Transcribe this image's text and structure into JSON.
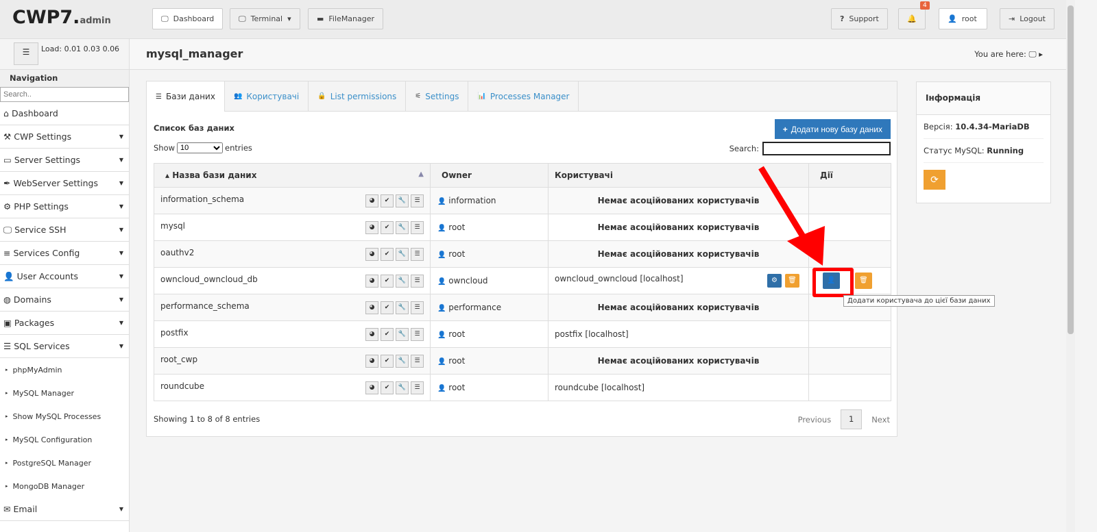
{
  "brand": {
    "name": "CWP7.",
    "suffix": "admin"
  },
  "topbar": {
    "dashboard": "Dashboard",
    "terminal": "Terminal",
    "filemanager": "FileManager",
    "support": "Support",
    "notifications": "4",
    "user": "root",
    "logout": "Logout"
  },
  "sidebar": {
    "load": "Load: 0.01  0.03  0.06",
    "nav_title": "Navigation",
    "search_placeholder": "Search..",
    "items": [
      {
        "label": "Dashboard",
        "icon": "home-icon"
      },
      {
        "label": "CWP Settings",
        "icon": "tools-icon"
      },
      {
        "label": "Server Settings",
        "icon": "server-icon"
      },
      {
        "label": "WebServer Settings",
        "icon": "feather-icon"
      },
      {
        "label": "PHP Settings",
        "icon": "gear-icon"
      },
      {
        "label": "Service SSH",
        "icon": "monitor-icon"
      },
      {
        "label": "Services Config",
        "icon": "list-icon"
      },
      {
        "label": "User Accounts",
        "icon": "user-icon"
      },
      {
        "label": "Domains",
        "icon": "globe-icon"
      },
      {
        "label": "Packages",
        "icon": "package-icon"
      },
      {
        "label": "SQL Services",
        "icon": "database-icon"
      }
    ],
    "sub": [
      "phpMyAdmin",
      "MySQL Manager",
      "Show MySQL Processes",
      "MySQL Configuration",
      "PostgreSQL Manager",
      "MongoDB Manager"
    ],
    "email": "Email"
  },
  "page": {
    "title": "mysql_manager",
    "you_are_here": "You are here:"
  },
  "tabs": [
    "Бази даних",
    "Користувачі",
    "List permissions",
    "Settings",
    "Processes Manager"
  ],
  "list": {
    "title": "Список баз даних",
    "add_button": "Додати нову базу даних",
    "show": "Show",
    "show_value": "10",
    "entries": "entries",
    "search": "Search:",
    "columns": [
      "Назва бази даних",
      "Owner",
      "Користувачі",
      "Дії"
    ],
    "rows": [
      {
        "name": "information_schema",
        "owner": "information",
        "users": "Немає асоційованих користувачів",
        "none": true
      },
      {
        "name": "mysql",
        "owner": "root",
        "users": "Немає асоційованих користувачів",
        "none": true
      },
      {
        "name": "oauthv2",
        "owner": "root",
        "users": "Немає асоційованих користувачів",
        "none": true
      },
      {
        "name": "owncloud_owncloud_db",
        "owner": "owncloud",
        "users": "owncloud_owncloud [localhost]",
        "none": false,
        "actions": true
      },
      {
        "name": "performance_schema",
        "owner": "performance",
        "users": "Немає асоційованих користувачів",
        "none": true
      },
      {
        "name": "postfix",
        "owner": "root",
        "users": "postfix [localhost]",
        "none": false
      },
      {
        "name": "root_cwp",
        "owner": "root",
        "users": "Немає асоційованих користувачів",
        "none": true
      },
      {
        "name": "roundcube",
        "owner": "root",
        "users": "roundcube [localhost]",
        "none": false
      }
    ],
    "footer": "Showing 1 to 8 of 8 entries",
    "previous": "Previous",
    "page": "1",
    "next": "Next"
  },
  "tooltip": "Додати користувача до цієї бази даних",
  "info": {
    "title": "Інформація",
    "version_label": "Версія:",
    "version": "10.4.34-MariaDB",
    "status_label": "Статус MySQL:",
    "status": "Running"
  },
  "colors": {
    "primary": "#2f78bb",
    "warning": "#f0a030",
    "highlight": "#ff0000"
  }
}
